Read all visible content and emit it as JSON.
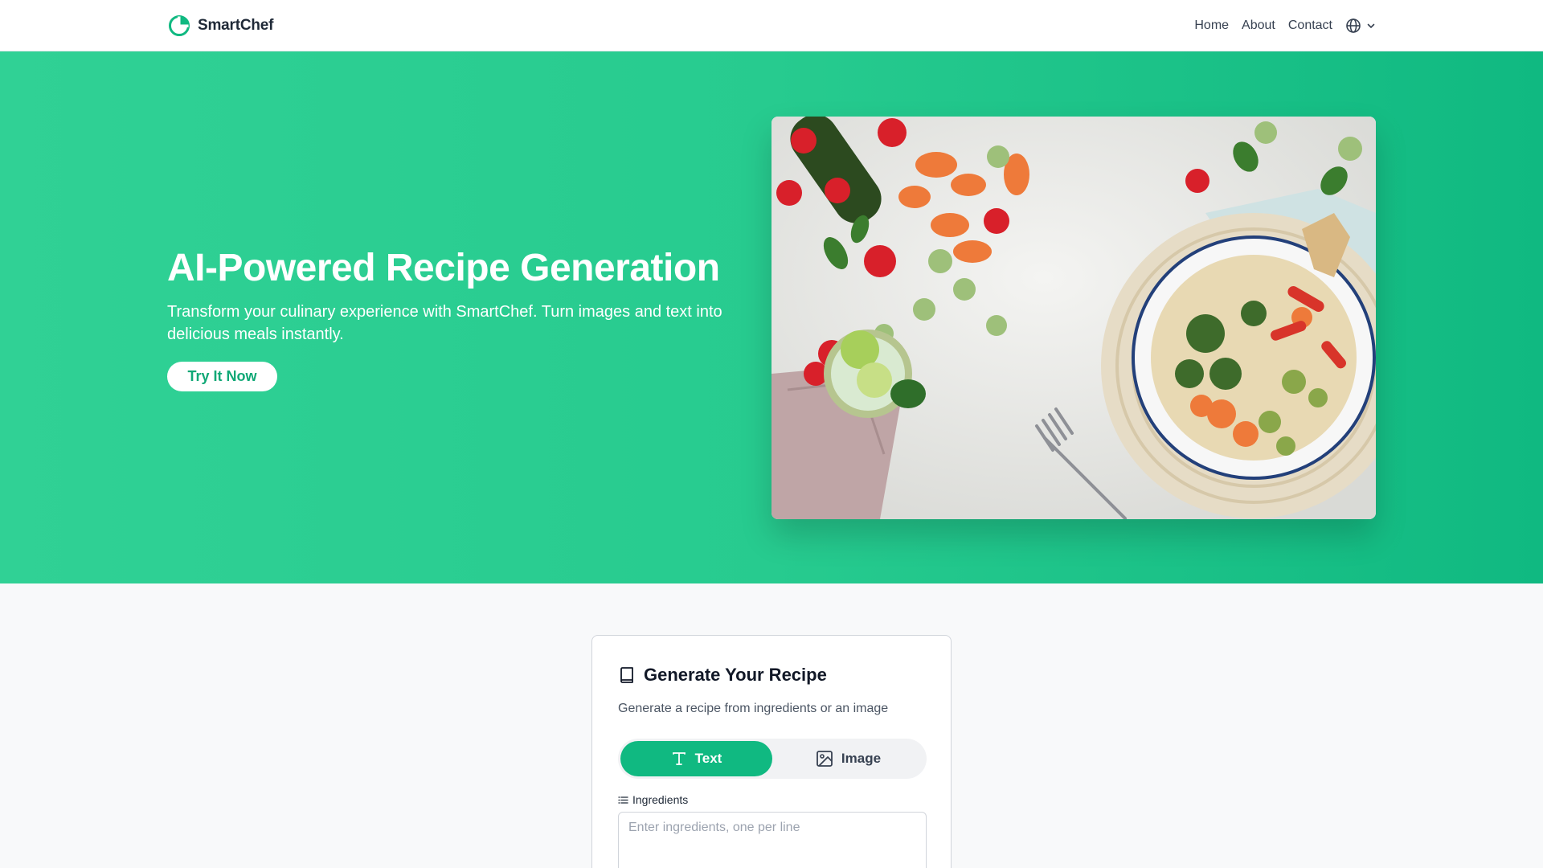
{
  "brand": {
    "name": "SmartChef",
    "color": "#10b981"
  },
  "nav": {
    "links": [
      "Home",
      "About",
      "Contact"
    ],
    "language_icon": "globe-icon"
  },
  "hero": {
    "title": "AI-Powered Recipe Generation",
    "subtitle": "Transform your culinary experience with SmartChef. Turn images and text into delicious meals instantly.",
    "cta_label": "Try It Now",
    "image_icon": "food-photo"
  },
  "recipe": {
    "title": "Generate Your Recipe",
    "description": "Generate a recipe from ingredients or an image",
    "modes": [
      {
        "label": "Text",
        "icon": "text-icon",
        "active": true
      },
      {
        "label": "Image",
        "icon": "image-icon",
        "active": false
      }
    ],
    "ingredients_label": "Ingredients",
    "ingredients_placeholder": "Enter ingredients, one per line",
    "ingredients_value": ""
  },
  "colors": {
    "accent": "#10b981",
    "hero_gradient_start": "#30d195",
    "hero_gradient_end": "#10b981"
  }
}
